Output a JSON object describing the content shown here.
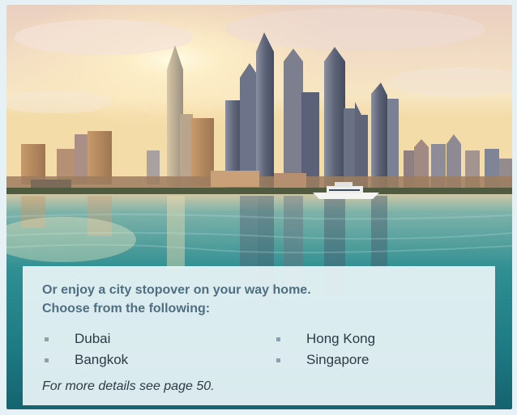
{
  "stopover": {
    "heading_line1": "Or enjoy a city stopover on your way home.",
    "heading_line2": "Choose from the following:",
    "cities_left": [
      "Dubai",
      "Bangkok"
    ],
    "cities_right": [
      "Hong Kong",
      "Singapore"
    ],
    "note": "For more details see page 50."
  },
  "colors": {
    "page_background": "#e6f1f6",
    "panel": "#e9f4f7",
    "heading_text": "#4f6f80",
    "body_text": "#2c3b45",
    "bullet": "#8aa3b0"
  }
}
